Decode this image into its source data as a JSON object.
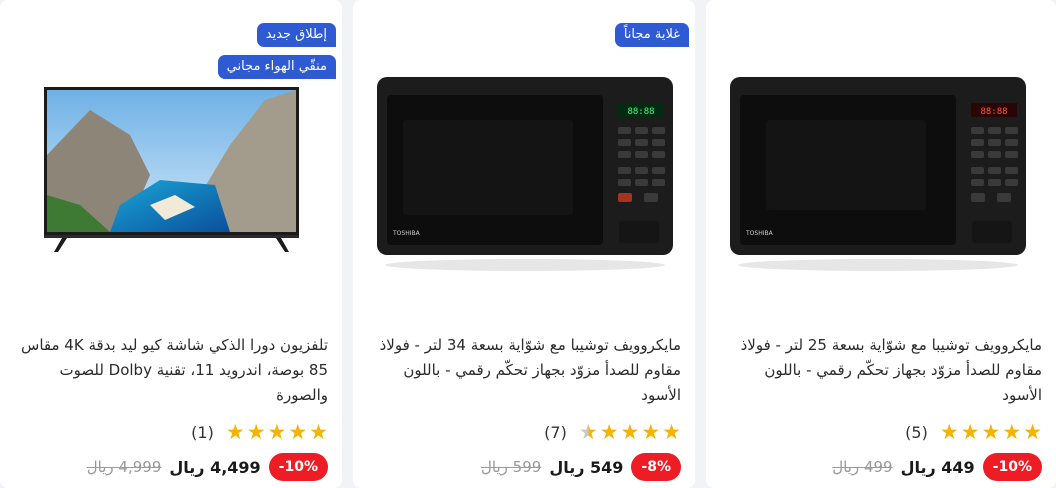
{
  "products": [
    {
      "badges": [
        "غلاية مجاناً"
      ],
      "title": "مايكروويف توشيبا مع شوّاية بسعة 34 لتر - فولاذ مقاوم للصدأ مزوّد بجهاز تحكّم رقمي - باللون الأسود",
      "rating_count": "(7)",
      "rating_value": 4.5,
      "discount": "-8%",
      "price": "549 ريال",
      "old_price": "599 ريال",
      "brand_label": "TOSHIBA",
      "display": "88:88"
    },
    {
      "badges": [],
      "title": "مايكروويف توشيبا مع شوّاية بسعة 25 لتر - فولاذ مقاوم للصدأ مزوّد بجهاز تحكّم رقمي - باللون الأسود",
      "rating_count": "(5)",
      "rating_value": 5,
      "discount": "-10%",
      "price": "449 ريال",
      "old_price": "499 ريال",
      "brand_label": "TOSHIBA",
      "display": "88:88"
    },
    {
      "badges": [
        "إطلاق جديد",
        "منقّي الهواء مجاني"
      ],
      "title": "تلفزيون دورا الذكي شاشة كيو ليد بدقة 4K مقاس 85 بوصة، اندرويد 11، تقنية Dolby للصوت والصورة",
      "rating_count": "(1)",
      "rating_value": 5,
      "discount": "-10%",
      "price": "4,499 ريال",
      "old_price": "4,999 ريال"
    }
  ]
}
